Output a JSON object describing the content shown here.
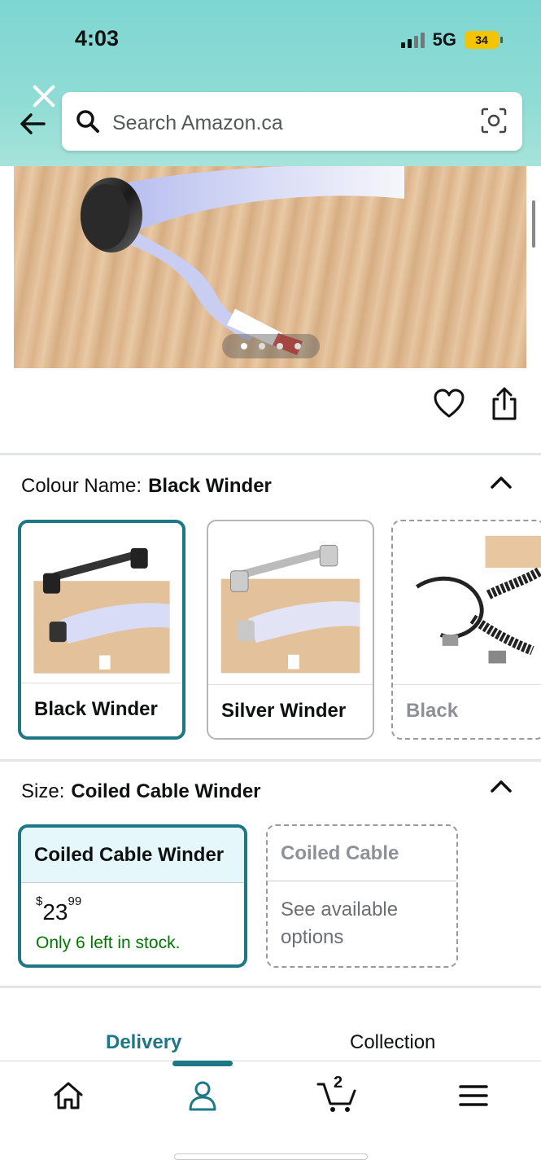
{
  "status_bar": {
    "time": "4:03",
    "network": "5G",
    "battery": "34"
  },
  "search": {
    "placeholder": "Search Amazon.ca"
  },
  "product_image": {
    "pager_count": 4,
    "active_index": 1
  },
  "colour": {
    "label": "Colour Name:",
    "selected": "Black Winder",
    "options": [
      {
        "label": "Black Winder",
        "state": "selected"
      },
      {
        "label": "Silver Winder",
        "state": "available"
      },
      {
        "label": "Black",
        "state": "unavailable"
      }
    ]
  },
  "size": {
    "label": "Size:",
    "selected": "Coiled Cable Winder",
    "options": [
      {
        "label": "Coiled Cable Winder",
        "price_currency": "$",
        "price_whole": "23",
        "price_fraction": "99",
        "stock": "Only 6 left in stock."
      },
      {
        "label": "Coiled Cable",
        "note": "See available options"
      }
    ]
  },
  "fulfillment_tabs": {
    "delivery": "Delivery",
    "collection": "Collection"
  },
  "bottom_nav": {
    "cart_count": "2"
  },
  "colors": {
    "accent": "#1d7886",
    "stock_green": "#007600",
    "header_teal": "#8fdcd5"
  }
}
